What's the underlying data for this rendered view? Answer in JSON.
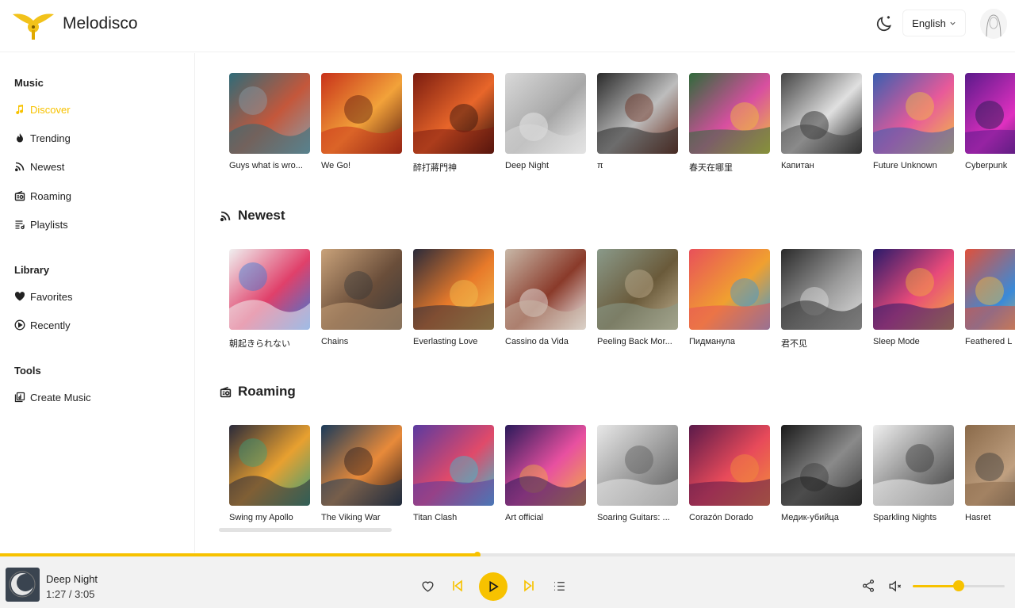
{
  "app": {
    "title": "Melodisco",
    "accent": "#f7c200"
  },
  "header": {
    "language": "English",
    "theme_icon": "moon-star-icon",
    "avatar_icon": "user-avatar"
  },
  "sidebar": {
    "sections": [
      {
        "title": "Music",
        "items": [
          {
            "label": "Discover",
            "icon": "music-note-icon",
            "active": true
          },
          {
            "label": "Trending",
            "icon": "flame-icon"
          },
          {
            "label": "Newest",
            "icon": "rss-icon"
          },
          {
            "label": "Roaming",
            "icon": "radio-icon"
          },
          {
            "label": "Playlists",
            "icon": "playlist-icon"
          }
        ]
      },
      {
        "title": "Library",
        "items": [
          {
            "label": "Favorites",
            "icon": "heart-icon"
          },
          {
            "label": "Recently",
            "icon": "play-circle-icon"
          }
        ]
      },
      {
        "title": "Tools",
        "items": [
          {
            "label": "Create Music",
            "icon": "create-music-icon"
          }
        ]
      }
    ]
  },
  "rows": [
    {
      "heading": "",
      "icon": "",
      "songs": [
        {
          "title": "Guys what is wro...",
          "colors": [
            "#2f6b78",
            "#c4573b",
            "#8b9ea8"
          ]
        },
        {
          "title": "We Go!",
          "colors": [
            "#c8321a",
            "#f2a23a",
            "#5a1a0e"
          ]
        },
        {
          "title": "醉打蔣門神",
          "colors": [
            "#7b1c10",
            "#e8662a",
            "#2b0f0b"
          ]
        },
        {
          "title": "Deep Night",
          "colors": [
            "#d9d9d9",
            "#a7a7a7",
            "#f1f1f1"
          ]
        },
        {
          "title": "π",
          "colors": [
            "#2a2a2a",
            "#bdbdbd",
            "#6b2d1d"
          ]
        },
        {
          "title": "春天在哪里",
          "colors": [
            "#2f6a3a",
            "#d84fa0",
            "#f1c23a"
          ]
        },
        {
          "title": "Капитан",
          "colors": [
            "#444444",
            "#e0e0e0",
            "#1b1b1b"
          ]
        },
        {
          "title": "Future Unknown",
          "colors": [
            "#3a5fb0",
            "#e85a9a",
            "#f2c040"
          ]
        },
        {
          "title": "Cyberpunk",
          "colors": [
            "#5a1a8a",
            "#e030c0",
            "#1a1a4a"
          ]
        }
      ]
    },
    {
      "heading": "Newest",
      "icon": "rss-icon",
      "songs": [
        {
          "title": "朝起きられない",
          "colors": [
            "#f0f0f0",
            "#e0406a",
            "#3a7ad8"
          ]
        },
        {
          "title": "Chains",
          "colors": [
            "#c9a27a",
            "#6a4e3a",
            "#3a3a3a"
          ]
        },
        {
          "title": "Everlasting Love",
          "colors": [
            "#2a2a3a",
            "#e87a2a",
            "#f2c050"
          ]
        },
        {
          "title": "Cassino da Vida",
          "colors": [
            "#c8b8a8",
            "#8a3a2a",
            "#f0f0f0"
          ]
        },
        {
          "title": "Peeling Back Mor...",
          "colors": [
            "#8a9a8a",
            "#6a5a3a",
            "#c0b090"
          ]
        },
        {
          "title": "Пидманула",
          "colors": [
            "#e8505a",
            "#f0a030",
            "#3a9ad8"
          ]
        },
        {
          "title": "君不见",
          "colors": [
            "#2a2a2a",
            "#9a9a9a",
            "#e0e0e0"
          ]
        },
        {
          "title": "Sleep Mode",
          "colors": [
            "#2a1a6a",
            "#e84a7a",
            "#f2b03a"
          ]
        },
        {
          "title": "Feathered L",
          "colors": [
            "#e0503a",
            "#3a8ad8",
            "#f2c040"
          ]
        }
      ]
    },
    {
      "heading": "Roaming",
      "icon": "radio-icon",
      "songs": [
        {
          "title": "Swing my Apollo",
          "colors": [
            "#2a2a3a",
            "#e8a030",
            "#3aa07a"
          ]
        },
        {
          "title": "The Viking War",
          "colors": [
            "#1a3a5a",
            "#e88a3a",
            "#2a1a1a"
          ]
        },
        {
          "title": "Titan Clash",
          "colors": [
            "#5a3aa0",
            "#e04a6a",
            "#3ac0d0"
          ]
        },
        {
          "title": "Art official",
          "colors": [
            "#2a1a5a",
            "#e850a0",
            "#f2b040"
          ]
        },
        {
          "title": "Soaring Guitars: ...",
          "colors": [
            "#e8e8e8",
            "#9a9a9a",
            "#5a5a5a"
          ]
        },
        {
          "title": "Corazón Dorado",
          "colors": [
            "#5a1a4a",
            "#e84a5a",
            "#f2903a"
          ]
        },
        {
          "title": "Медик-убийца",
          "colors": [
            "#1a1a1a",
            "#8a8a8a",
            "#3a3a3a"
          ]
        },
        {
          "title": "Sparkling Nights",
          "colors": [
            "#f0f0f0",
            "#8a8a8a",
            "#3a3a3a"
          ]
        },
        {
          "title": "Hasret",
          "colors": [
            "#8a6a4a",
            "#c0a080",
            "#3a3a3a"
          ]
        }
      ]
    }
  ],
  "player": {
    "title": "Deep Night",
    "time": "1:27 / 3:05",
    "progress": 0.47,
    "volume": 0.5
  }
}
